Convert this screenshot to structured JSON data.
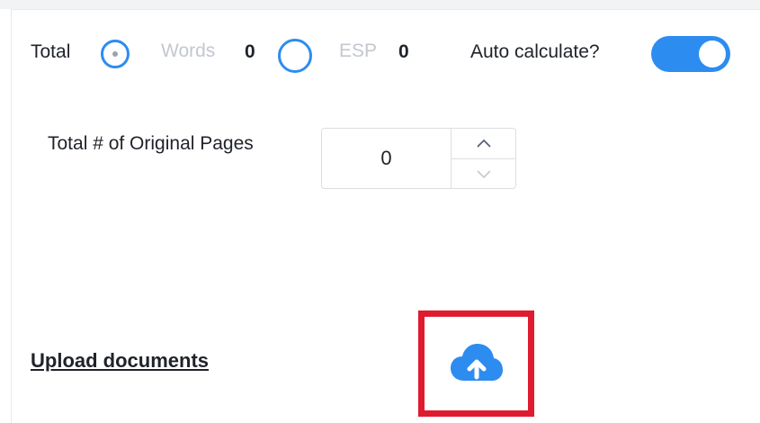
{
  "count_mode": {
    "total_label": "Total",
    "words_label": "Words",
    "words_value": "0",
    "esp_label": "ESP",
    "esp_value": "0",
    "selected": "Total"
  },
  "auto_calculate": {
    "label": "Auto calculate?",
    "enabled": true
  },
  "original_pages": {
    "label": "Total # of Original Pages",
    "value": "0"
  },
  "upload": {
    "label": "Upload documents",
    "icon": "cloud-upload-icon"
  },
  "colors": {
    "accent": "#2d8cf0",
    "highlight_border": "#e01b2f",
    "disabled_text": "#c3c7cf"
  }
}
